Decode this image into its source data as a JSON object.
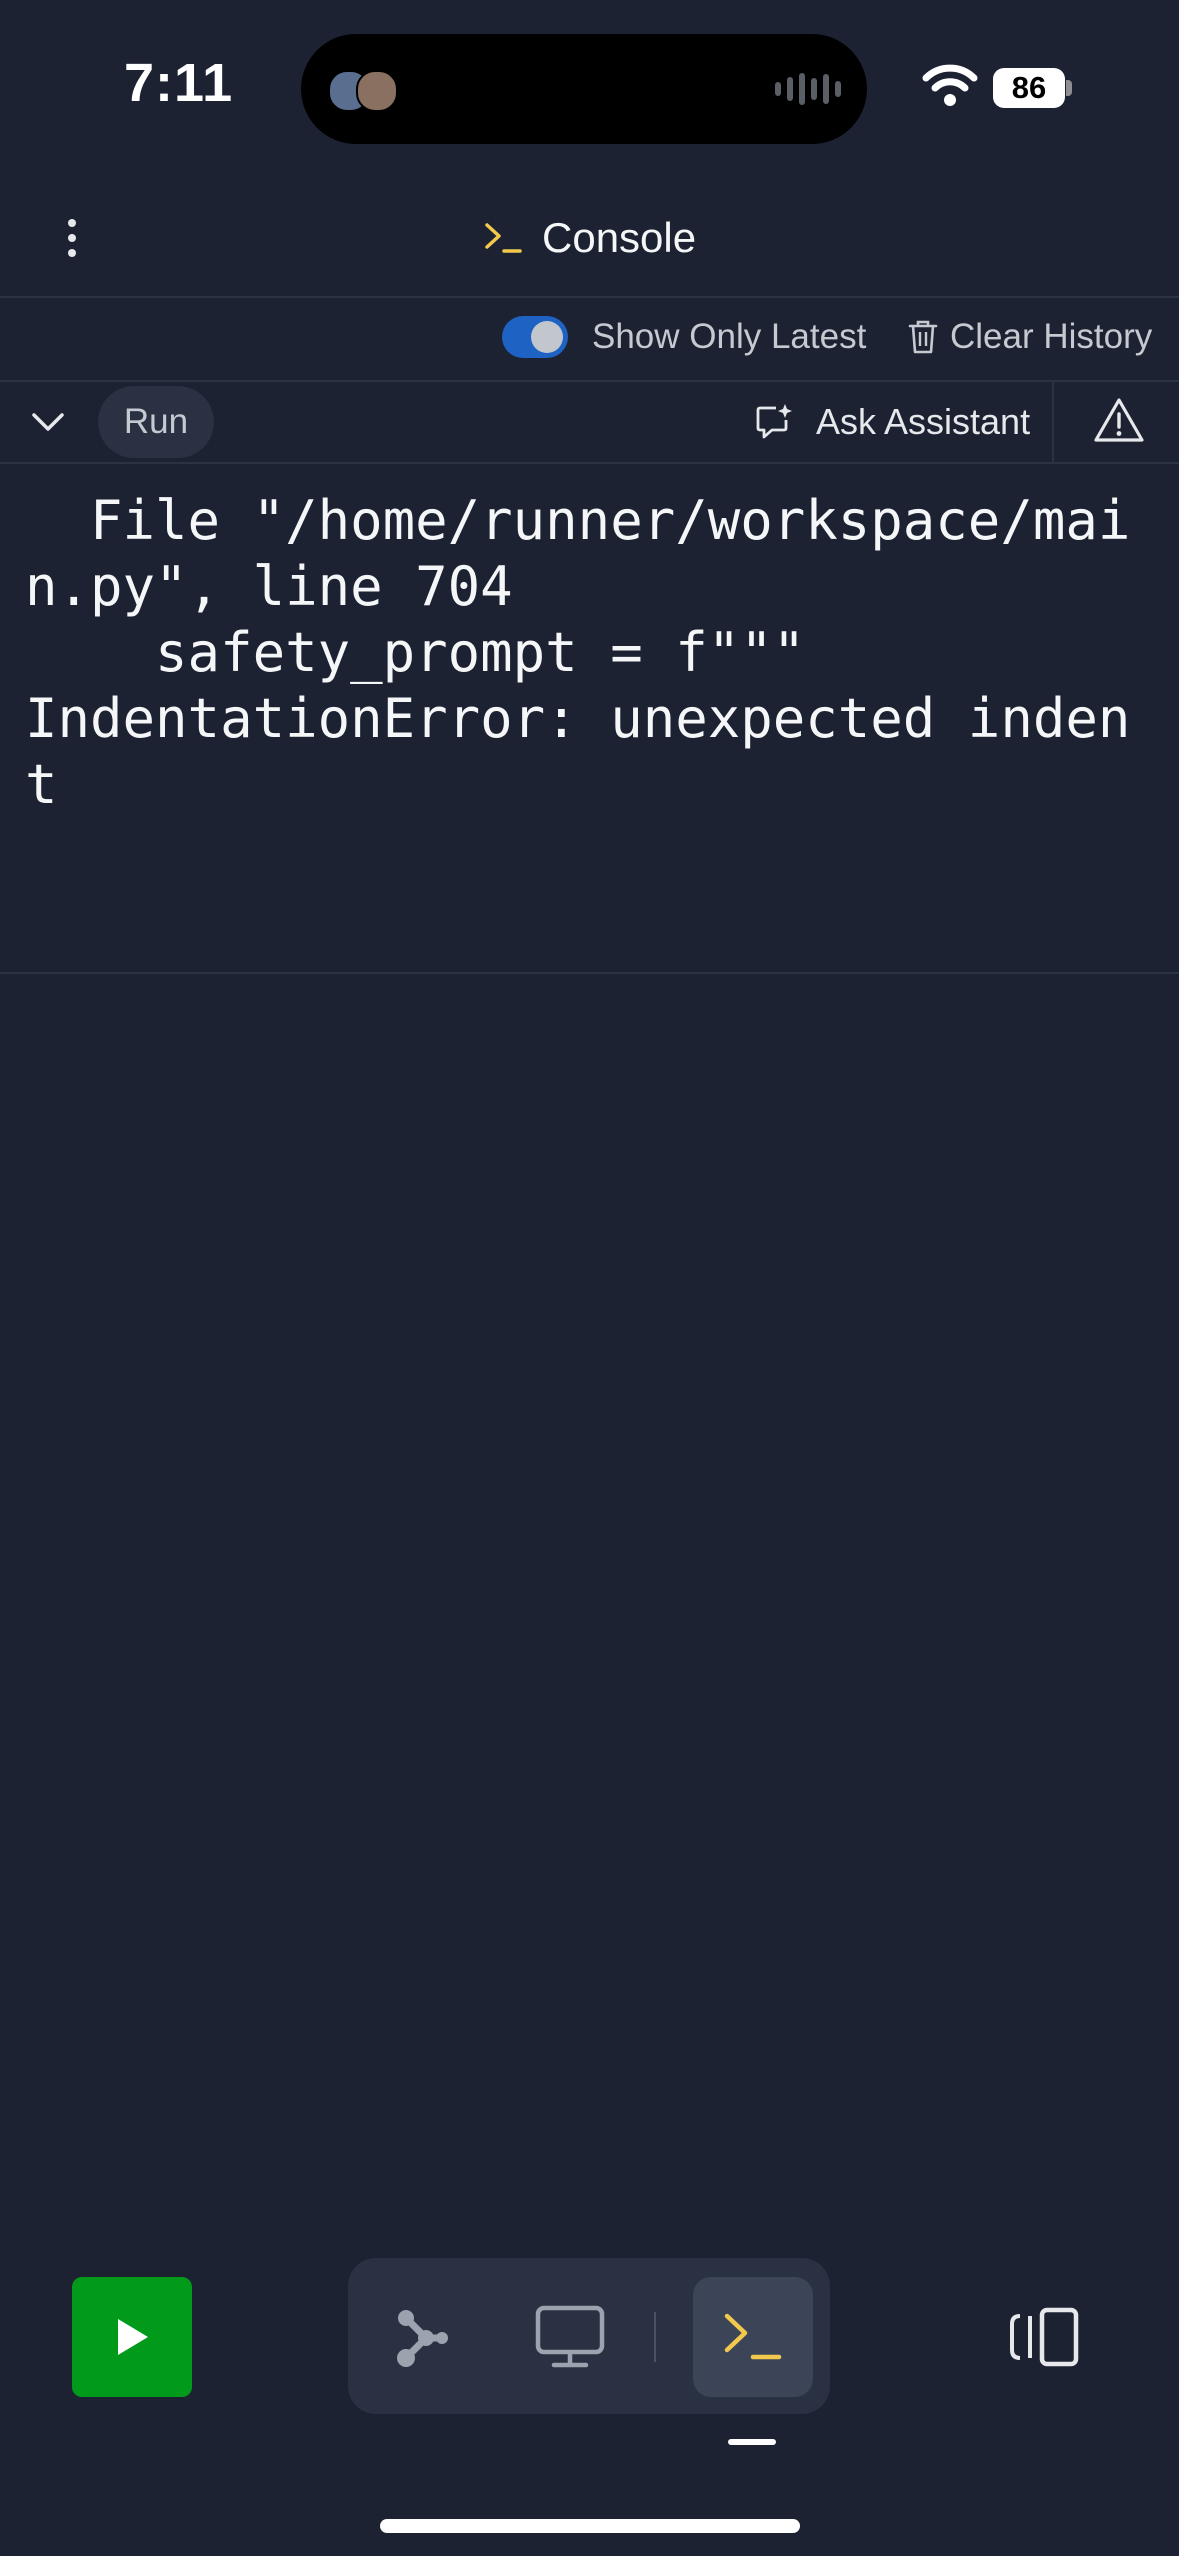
{
  "status_bar": {
    "time": "7:11",
    "battery": "86",
    "icons": [
      "wifi-icon",
      "battery-icon"
    ]
  },
  "header": {
    "title": "Console",
    "title_icon": "terminal-prompt-icon",
    "menu_icon": "vertical-dots-icon"
  },
  "toolbar": {
    "toggle_label": "Show Only Latest",
    "toggle_on": true,
    "clear_label": "Clear History",
    "clear_icon": "trash-icon"
  },
  "run_row": {
    "collapse_icon": "chevron-down-icon",
    "run_label": "Run",
    "ask_label": "Ask Assistant",
    "ask_icon": "chat-sparkle-icon",
    "warning_icon": "warning-triangle-icon"
  },
  "console": {
    "output": "  File \"/home/runner/workspace/mai\nn.py\", line 704\n    safety_prompt = f\"\"\"\nIndentationError: unexpected inden\nt"
  },
  "bottom_bar": {
    "run_icon": "play-icon",
    "dock_items": [
      "graph-icon",
      "monitor-icon",
      "terminal-prompt-icon"
    ],
    "active_dock_item": "terminal-prompt-icon",
    "panel_icon": "side-panel-icon"
  },
  "colors": {
    "background": "#1c2232",
    "accent_yellow": "#f2c94c",
    "toggle_blue": "#1e63c4",
    "run_green": "#019a1b"
  }
}
